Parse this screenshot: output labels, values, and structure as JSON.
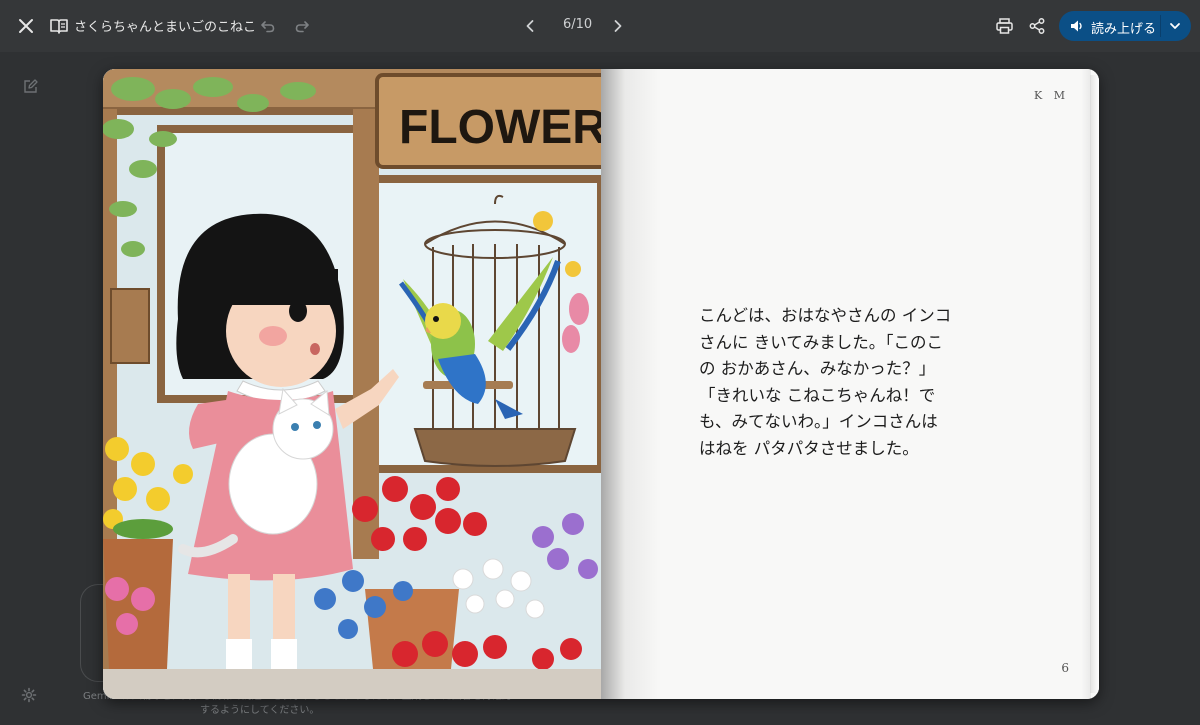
{
  "window": {
    "title": "さくらちゃんとまいごのこねこ",
    "page_indicator": "6/10",
    "read_aloud_label": "読み上げる"
  },
  "icons": {
    "close": "close-icon",
    "book": "book-icon",
    "undo": "undo-icon",
    "redo": "redo-icon",
    "prev": "chevron-left-icon",
    "next": "chevron-right-icon",
    "print": "print-icon",
    "share": "share-icon",
    "speaker": "speaker-icon",
    "dropdown": "chevron-down-icon",
    "edit": "edit-icon",
    "settings": "settings-icon"
  },
  "book": {
    "left_page": {
      "illustration_sign": "FLOWER"
    },
    "right_page": {
      "initials": "K M",
      "story_lines": [
        "こんどは、おはなやさんの インコ",
        "さんに きいてみました。「このこ",
        "の おかあさん、みなかった？」",
        "「きれいな こねこちゃんね！で",
        "も、みてないわ。」インコさんは",
        "はねを パタパタさせました。"
      ],
      "page_number": "6"
    }
  },
  "footer": {
    "note_line1": "Gemini は人物などに関する情報で間違いを表示することがあるため、生成された回答を再確認",
    "note_line2": "するようにしてください。"
  },
  "colors": {
    "background": "#2f3133",
    "topbar": "#353739",
    "accent_button": "#0b4f86"
  }
}
